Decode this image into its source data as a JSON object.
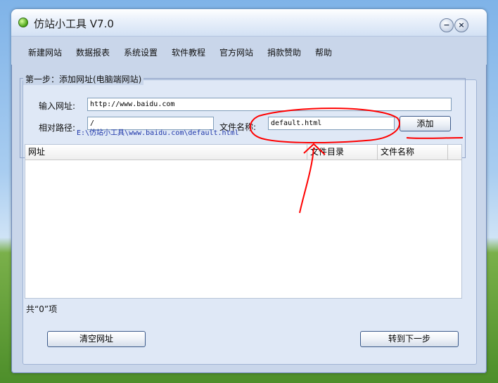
{
  "window": {
    "title": "仿站小工具 V7.0",
    "minimize_glyph": "−",
    "close_glyph": "×"
  },
  "menu": [
    "新建网站",
    "数据报表",
    "系统设置",
    "软件教程",
    "官方网站",
    "捐款赞助",
    "帮助"
  ],
  "step": {
    "legend": "第一步：添加网址(电脑端网站)",
    "url_label": "输入网址:",
    "url_value": "http://www.baidu.com",
    "relpath_label": "相对路径:",
    "relpath_value": "/",
    "filename_label": "文件名称:",
    "filename_value": "default.html",
    "add_button": "添加",
    "resolved_path": "E:\\仿站小工具\\www.baidu.com\\default.html"
  },
  "list": {
    "columns": [
      "网址",
      "文件目录",
      "文件名称"
    ],
    "rows": []
  },
  "footer": {
    "count_text": "共“0”项",
    "clear_button": "清空网址",
    "next_button": "转到下一步"
  },
  "colors": {
    "annotation": "#ff0000",
    "path_text": "#1d35a8"
  }
}
